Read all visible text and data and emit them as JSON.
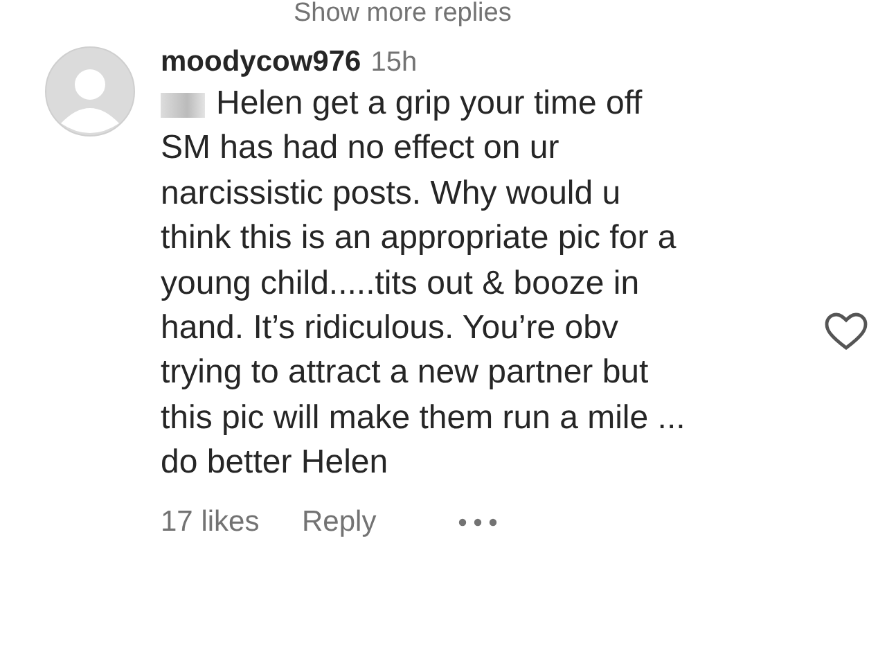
{
  "show_more_replies": "Show more replies",
  "comment": {
    "username": "moodycow976",
    "time": "15h",
    "redacted_prefix": true,
    "lines": [
      "Helen get a grip your time off",
      "SM has had no effect on ur",
      "narcissistic posts. Why would u",
      "think this is an appropriate pic for a",
      "young child.....tits out & booze in",
      "hand. It’s ridiculous. You’re obv",
      "trying to attract a new partner but",
      "this pic will make them run a mile ...",
      "do better Helen"
    ],
    "liked": false,
    "likes": "17 likes",
    "reply": "Reply"
  }
}
